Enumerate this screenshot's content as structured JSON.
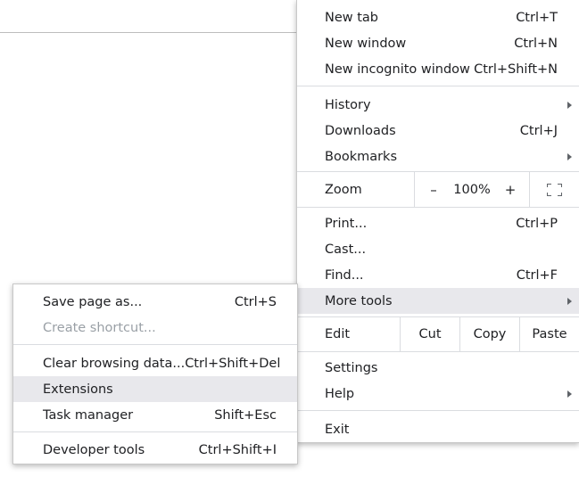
{
  "main_menu": {
    "new_tab": {
      "label": "New tab",
      "shortcut": "Ctrl+T"
    },
    "new_window": {
      "label": "New window",
      "shortcut": "Ctrl+N"
    },
    "new_incognito": {
      "label": "New incognito window",
      "shortcut": "Ctrl+Shift+N"
    },
    "history": {
      "label": "History"
    },
    "downloads": {
      "label": "Downloads",
      "shortcut": "Ctrl+J"
    },
    "bookmarks": {
      "label": "Bookmarks"
    },
    "zoom": {
      "label": "Zoom",
      "minus": "–",
      "value": "100%",
      "plus": "+",
      "fullscreen_icon": "fullscreen-icon"
    },
    "print": {
      "label": "Print...",
      "shortcut": "Ctrl+P"
    },
    "cast": {
      "label": "Cast..."
    },
    "find": {
      "label": "Find...",
      "shortcut": "Ctrl+F"
    },
    "more_tools": {
      "label": "More tools",
      "highlighted": true
    },
    "edit": {
      "label": "Edit",
      "cut": "Cut",
      "copy": "Copy",
      "paste": "Paste"
    },
    "settings": {
      "label": "Settings"
    },
    "help": {
      "label": "Help"
    },
    "exit": {
      "label": "Exit"
    }
  },
  "more_tools_submenu": {
    "save_page": {
      "label": "Save page as...",
      "shortcut": "Ctrl+S"
    },
    "create_shortcut": {
      "label": "Create shortcut...",
      "disabled": true
    },
    "clear_browsing": {
      "label": "Clear browsing data...",
      "shortcut": "Ctrl+Shift+Del"
    },
    "extensions": {
      "label": "Extensions",
      "highlighted": true
    },
    "task_manager": {
      "label": "Task manager",
      "shortcut": "Shift+Esc"
    },
    "developer_tools": {
      "label": "Developer tools",
      "shortcut": "Ctrl+Shift+I"
    }
  },
  "colors": {
    "highlight": "#e8e8ec",
    "text": "#202124",
    "disabled_text": "#9aa0a6",
    "separator": "#dadce0"
  }
}
